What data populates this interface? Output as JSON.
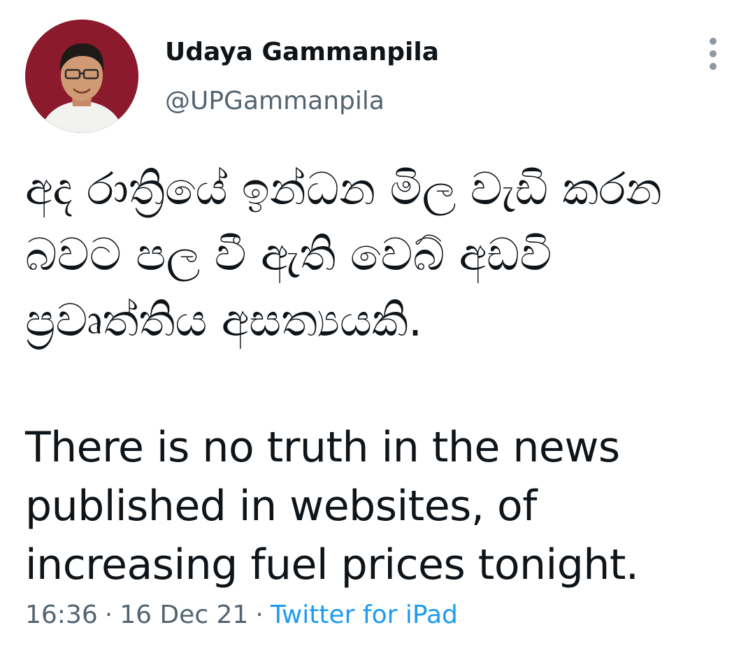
{
  "author": {
    "name": "Udaya Gammanpila",
    "handle": "@UPGammanpila",
    "avatar": "profile-photo"
  },
  "tweet": {
    "text_sinhala": "අද රාත්‍රියේ ඉන්ධන මිල වැඩි කරන බවට පල වී ඇති වෙබ් අඩවි ප්‍රවෘත්තිය අසත්‍යයකි.",
    "text_english": "There is no truth in the news published in websites, of increasing fuel prices tonight.",
    "time": "16:36",
    "separator": "·",
    "date": "16 Dec 21",
    "source": "Twitter for iPad"
  },
  "icons": {
    "more": "more-vertical-icon"
  },
  "colors": {
    "text_primary": "#0f1419",
    "text_secondary": "#536471",
    "link": "#1d9bf0",
    "avatar_background": "#8b1a2c"
  }
}
